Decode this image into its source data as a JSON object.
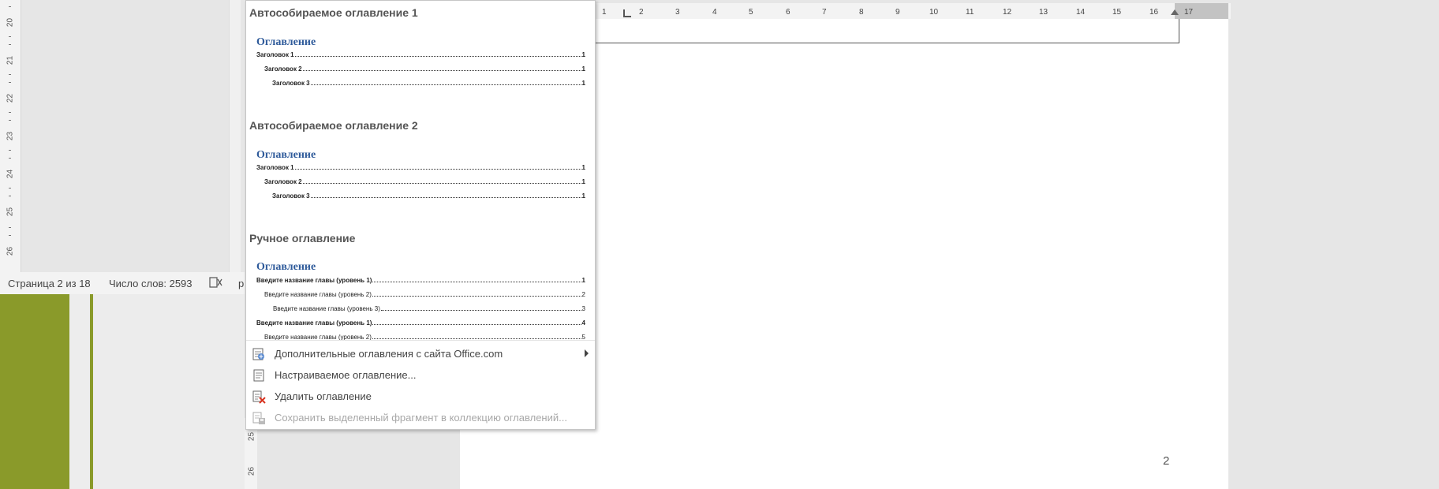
{
  "status_bar": {
    "page_info": "Страница 2 из 18",
    "word_count": "Число слов: 2593",
    "extra": "р"
  },
  "left_ruler": {
    "numbers": [
      "20",
      "21",
      "22",
      "23",
      "24",
      "25",
      "26"
    ]
  },
  "mid_ruler": {
    "numbers": [
      "25",
      "26"
    ]
  },
  "top_ruler": {
    "numbers": [
      "1",
      "2",
      "3",
      "4",
      "5",
      "6",
      "7",
      "8",
      "9",
      "10",
      "11",
      "12",
      "13",
      "14",
      "15",
      "16",
      "17"
    ]
  },
  "page": {
    "page_number": "2"
  },
  "dropdown": {
    "sections": [
      {
        "title": "Автособираемое оглавление 1",
        "heading": "Оглавление",
        "lines": [
          {
            "text": "Заголовок 1",
            "page": "1"
          },
          {
            "text": "Заголовок 2",
            "page": "1"
          },
          {
            "text": "Заголовок 3",
            "page": "1"
          }
        ]
      },
      {
        "title": "Автособираемое оглавление 2",
        "heading": "Оглавление",
        "lines": [
          {
            "text": "Заголовок 1",
            "page": "1"
          },
          {
            "text": "Заголовок 2",
            "page": "1"
          },
          {
            "text": "Заголовок 3",
            "page": "1"
          }
        ]
      },
      {
        "title": "Ручное оглавление",
        "heading": "Оглавление",
        "lines": [
          {
            "text": "Введите название главы (уровень 1)",
            "page": "1"
          },
          {
            "text": "Введите название главы (уровень 2)",
            "page": "2"
          },
          {
            "text": "Введите название главы (уровень 3)",
            "page": "3"
          },
          {
            "text": "Введите название главы (уровень 1)",
            "page": "4"
          },
          {
            "text": "Введите название главы (уровень 2)",
            "page": "5"
          }
        ]
      }
    ],
    "menu": [
      {
        "label": "Дополнительные оглавления с сайта Office.com",
        "icon": "office-toc-icon",
        "enabled": true,
        "submenu": true
      },
      {
        "label": "Настраиваемое оглавление...",
        "icon": "custom-toc-icon",
        "enabled": true,
        "submenu": false
      },
      {
        "label": "Удалить оглавление",
        "icon": "delete-toc-icon",
        "enabled": true,
        "submenu": false
      },
      {
        "label": "Сохранить выделенный фрагмент в коллекцию оглавлений...",
        "icon": "save-toc-icon",
        "enabled": false,
        "submenu": false
      }
    ]
  },
  "colors": {
    "accent_green": "#8a9a2a",
    "toc_heading_blue": "#2e5a9a",
    "delete_red": "#d9331f"
  }
}
